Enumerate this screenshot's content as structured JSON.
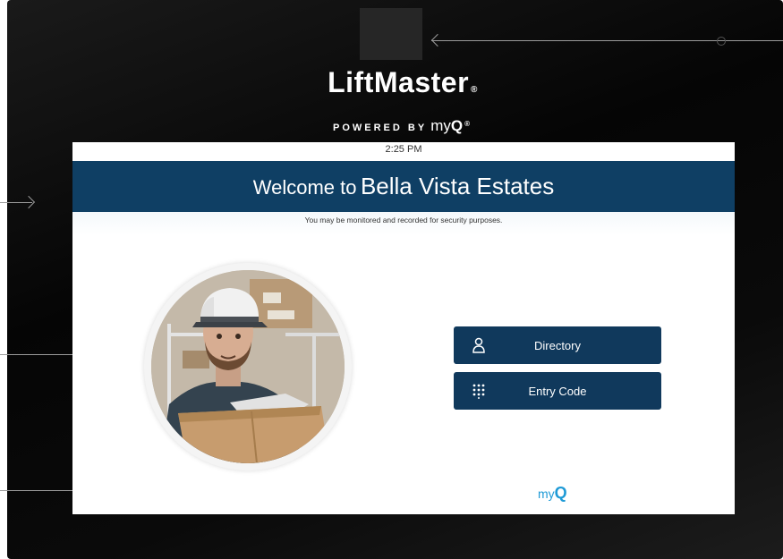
{
  "device": {
    "brand_name": "LiftMaster",
    "brand_mark": "®",
    "powered_by": "POWERED BY",
    "powered_brand_prefix": "my",
    "powered_brand_suffix": "Q",
    "powered_mark": "®"
  },
  "screen": {
    "time": "2:25 PM",
    "welcome_prefix": "Welcome to",
    "property_name": "Bella Vista Estates",
    "notice": "You may be monitored and recorded for security purposes.",
    "buttons": [
      {
        "label": "Directory",
        "icon": "person-icon"
      },
      {
        "label": "Entry Code",
        "icon": "keypad-icon"
      }
    ],
    "footer_brand_prefix": "my",
    "footer_brand_suffix": "Q"
  },
  "colors": {
    "banner": "#0f3f64",
    "button": "#10395c",
    "accent": "#1e9ad6",
    "bezel": "#050505"
  }
}
